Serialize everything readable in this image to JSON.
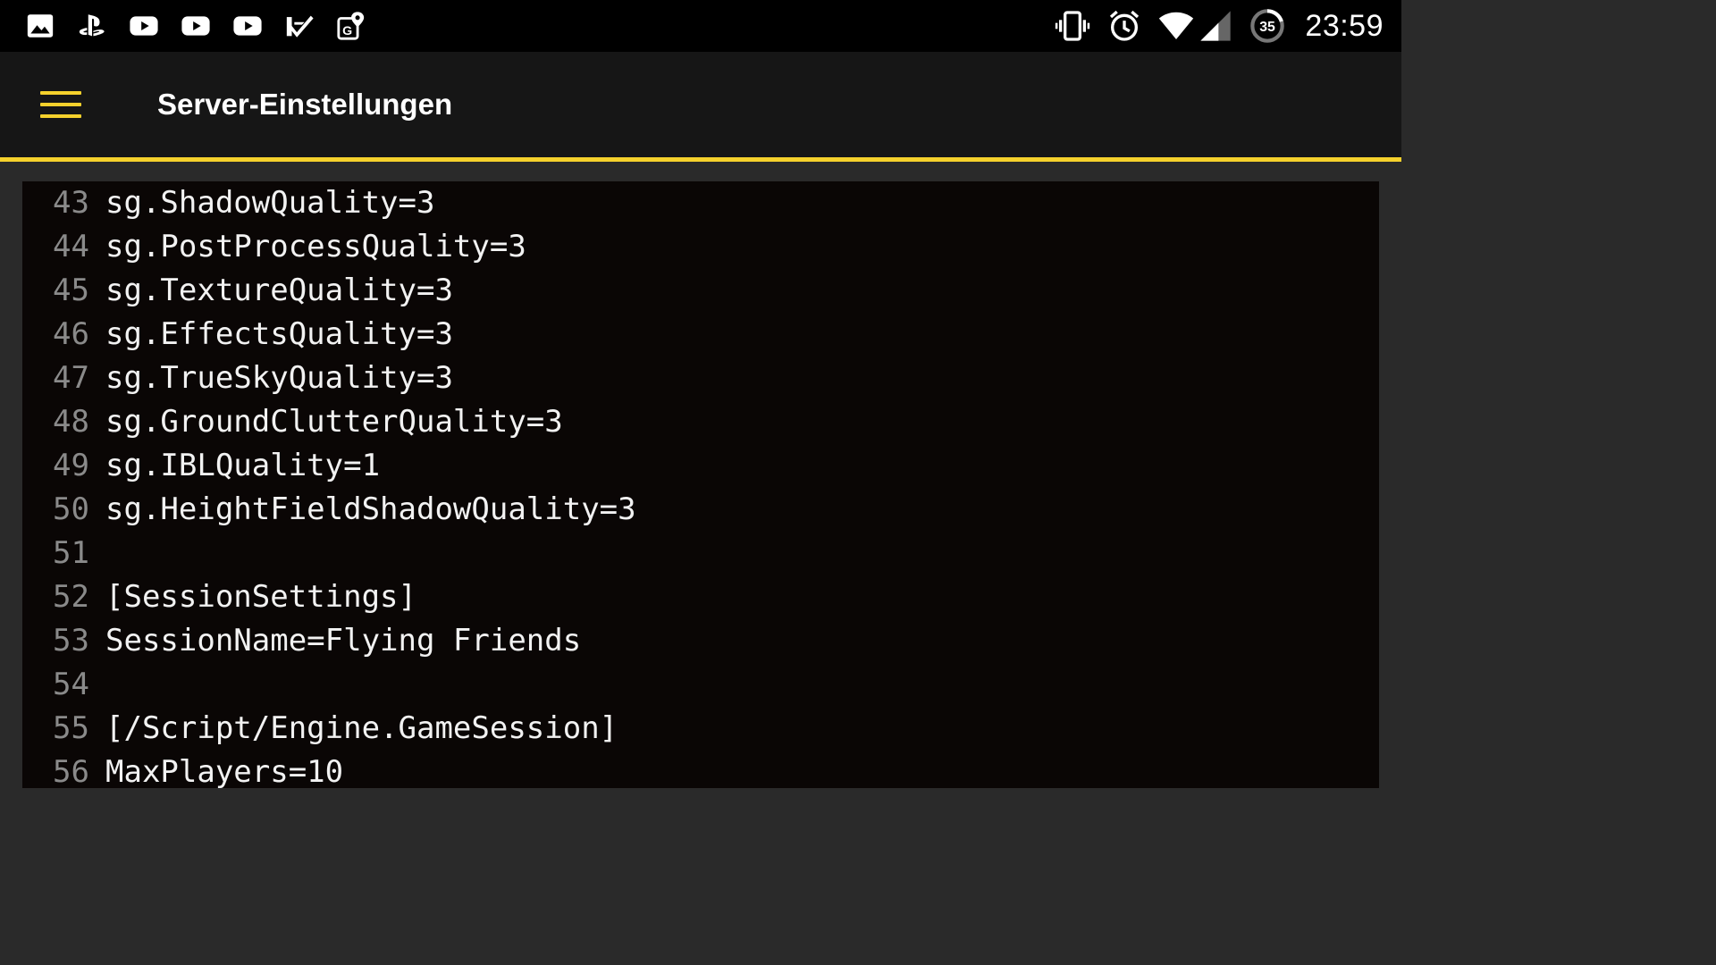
{
  "status_bar": {
    "notification_icons": [
      "gallery-icon",
      "playstation-icon",
      "youtube-icon",
      "youtube-icon",
      "youtube-icon",
      "tasks-check-icon",
      "map-pin-icon"
    ],
    "system_icons": [
      "vibrate-icon",
      "alarm-icon",
      "wifi-icon",
      "cell-signal-icon",
      "battery-saver-icon"
    ],
    "battery_badge": "35",
    "time": "23:59"
  },
  "app_bar": {
    "title": "Server-Einstellungen",
    "menu_icon": "hamburger-menu-icon",
    "accent_color": "#f5d12c"
  },
  "editor": {
    "lines": [
      {
        "no": "43",
        "text": "sg.ShadowQuality=3"
      },
      {
        "no": "44",
        "text": "sg.PostProcessQuality=3"
      },
      {
        "no": "45",
        "text": "sg.TextureQuality=3"
      },
      {
        "no": "46",
        "text": "sg.EffectsQuality=3"
      },
      {
        "no": "47",
        "text": "sg.TrueSkyQuality=3"
      },
      {
        "no": "48",
        "text": "sg.GroundClutterQuality=3"
      },
      {
        "no": "49",
        "text": "sg.IBLQuality=1"
      },
      {
        "no": "50",
        "text": "sg.HeightFieldShadowQuality=3"
      },
      {
        "no": "51",
        "text": ""
      },
      {
        "no": "52",
        "text": "[SessionSettings]"
      },
      {
        "no": "53",
        "text": "SessionName=Flying Friends"
      },
      {
        "no": "54",
        "text": ""
      },
      {
        "no": "55",
        "text": "[/Script/Engine.GameSession]"
      },
      {
        "no": "56",
        "text": "MaxPlayers=10"
      }
    ]
  }
}
